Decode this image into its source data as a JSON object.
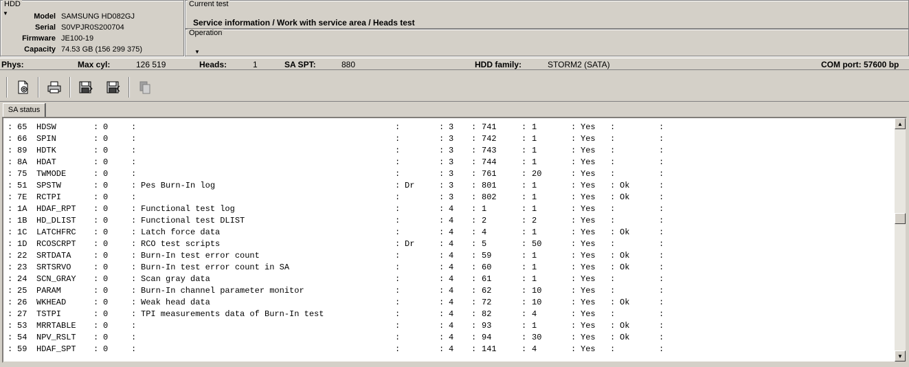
{
  "hdd": {
    "legend": "HDD",
    "fields": [
      {
        "label": "Model",
        "value": "SAMSUNG HD082GJ"
      },
      {
        "label": "Serial",
        "value": "S0VPJR0S200704"
      },
      {
        "label": "Firmware",
        "value": "JE100-19"
      },
      {
        "label": "Capacity",
        "value": "74.53 GB (156 299 375)"
      }
    ]
  },
  "current_test": {
    "legend": "Current test",
    "path": "Service information / Work with service area / Heads test"
  },
  "operation": {
    "legend": "Operation"
  },
  "phys": {
    "phys_label": "Phys:",
    "maxcyl_label": "Max cyl:",
    "maxcyl_value": "126 519",
    "heads_label": "Heads:",
    "heads_value": "1",
    "saspt_label": "SA SPT:",
    "saspt_value": "880",
    "family_label": "HDD family:",
    "family_value": "STORM2 (SATA)",
    "com_port": "COM port: 57600 bp"
  },
  "toolbar": {
    "icons": [
      "settings-page-icon",
      "print-icon",
      "save-disk-icon",
      "save-disk-icon",
      "copy-icon"
    ]
  },
  "tabs": [
    {
      "label": "SA status"
    }
  ],
  "sa_rows": [
    {
      "id": "65",
      "name": "HDSW",
      "z": "0",
      "desc": "",
      "dr": "",
      "h": "3",
      "num": "741",
      "cnt": "1",
      "yes": "Yes",
      "ok": ""
    },
    {
      "id": "66",
      "name": "SPIN",
      "z": "0",
      "desc": "",
      "dr": "",
      "h": "3",
      "num": "742",
      "cnt": "1",
      "yes": "Yes",
      "ok": ""
    },
    {
      "id": "89",
      "name": "HDTK",
      "z": "0",
      "desc": "",
      "dr": "",
      "h": "3",
      "num": "743",
      "cnt": "1",
      "yes": "Yes",
      "ok": ""
    },
    {
      "id": "8A",
      "name": "HDAT",
      "z": "0",
      "desc": "",
      "dr": "",
      "h": "3",
      "num": "744",
      "cnt": "1",
      "yes": "Yes",
      "ok": ""
    },
    {
      "id": "75",
      "name": "TWMODE",
      "z": "0",
      "desc": "",
      "dr": "",
      "h": "3",
      "num": "761",
      "cnt": "20",
      "yes": "Yes",
      "ok": ""
    },
    {
      "id": "51",
      "name": "SPSTW",
      "z": "0",
      "desc": "Pes Burn-In log",
      "dr": "Dr",
      "h": "3",
      "num": "801",
      "cnt": "1",
      "yes": "Yes",
      "ok": "Ok"
    },
    {
      "id": "7E",
      "name": "RCTPI",
      "z": "0",
      "desc": "",
      "dr": "",
      "h": "3",
      "num": "802",
      "cnt": "1",
      "yes": "Yes",
      "ok": "Ok"
    },
    {
      "id": "1A",
      "name": "HDAF_RPT",
      "z": "0",
      "desc": "Functional test log",
      "dr": "",
      "h": "4",
      "num": "1",
      "cnt": "1",
      "yes": "Yes",
      "ok": ""
    },
    {
      "id": "1B",
      "name": "HD_DLIST",
      "z": "0",
      "desc": "Functional test DLIST",
      "dr": "",
      "h": "4",
      "num": "2",
      "cnt": "2",
      "yes": "Yes",
      "ok": ""
    },
    {
      "id": "1C",
      "name": "LATCHFRC",
      "z": "0",
      "desc": "Latch force data",
      "dr": "",
      "h": "4",
      "num": "4",
      "cnt": "1",
      "yes": "Yes",
      "ok": "Ok"
    },
    {
      "id": "1D",
      "name": "RCOSCRPT",
      "z": "0",
      "desc": "RCO test scripts",
      "dr": "Dr",
      "h": "4",
      "num": "5",
      "cnt": "50",
      "yes": "Yes",
      "ok": ""
    },
    {
      "id": "22",
      "name": "SRTDATA",
      "z": "0",
      "desc": "Burn-In test error count",
      "dr": "",
      "h": "4",
      "num": "59",
      "cnt": "1",
      "yes": "Yes",
      "ok": "Ok"
    },
    {
      "id": "23",
      "name": "SRTSRVO",
      "z": "0",
      "desc": "Burn-In test error count in SA",
      "dr": "",
      "h": "4",
      "num": "60",
      "cnt": "1",
      "yes": "Yes",
      "ok": "Ok"
    },
    {
      "id": "24",
      "name": "SCN_GRAY",
      "z": "0",
      "desc": "Scan gray data",
      "dr": "",
      "h": "4",
      "num": "61",
      "cnt": "1",
      "yes": "Yes",
      "ok": ""
    },
    {
      "id": "25",
      "name": "PARAM",
      "z": "0",
      "desc": "Burn-In channel parameter monitor",
      "dr": "",
      "h": "4",
      "num": "62",
      "cnt": "10",
      "yes": "Yes",
      "ok": ""
    },
    {
      "id": "26",
      "name": "WKHEAD",
      "z": "0",
      "desc": "Weak head data",
      "dr": "",
      "h": "4",
      "num": "72",
      "cnt": "10",
      "yes": "Yes",
      "ok": "Ok"
    },
    {
      "id": "27",
      "name": "TSTPI",
      "z": "0",
      "desc": "TPI measurements data of Burn-In test",
      "dr": "",
      "h": "4",
      "num": "82",
      "cnt": "4",
      "yes": "Yes",
      "ok": ""
    },
    {
      "id": "53",
      "name": "MRRTABLE",
      "z": "0",
      "desc": "",
      "dr": "",
      "h": "4",
      "num": "93",
      "cnt": "1",
      "yes": "Yes",
      "ok": "Ok"
    },
    {
      "id": "54",
      "name": "NPV_RSLT",
      "z": "0",
      "desc": "",
      "dr": "",
      "h": "4",
      "num": "94",
      "cnt": "30",
      "yes": "Yes",
      "ok": "Ok"
    },
    {
      "id": "59",
      "name": "HDAF_SPT",
      "z": "0",
      "desc": "",
      "dr": "",
      "h": "4",
      "num": "141",
      "cnt": "4",
      "yes": "Yes",
      "ok": ""
    }
  ]
}
